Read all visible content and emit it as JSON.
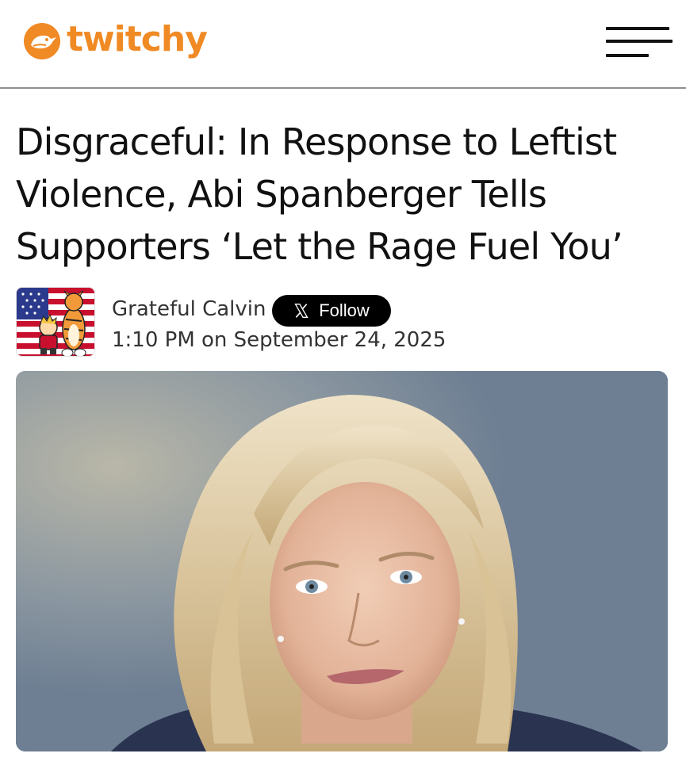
{
  "site": {
    "logo_text": "twitchy",
    "logo_icon": "bird-icon",
    "brand_color": "#f08a24",
    "menu_icon": "hamburger-menu-icon"
  },
  "article": {
    "title": "Disgraceful: In Response to Leftist Violence, Abi Spanberger Tells Supporters ‘Let the Rage Fuel You’",
    "author": {
      "name": "Grateful Calvin",
      "avatar_icon": "calvin-hobbes-flag-avatar",
      "follow_label": "Follow",
      "follow_icon": "x-logo-icon"
    },
    "timestamp": "1:10 PM on September 24, 2025",
    "hero_image_subject": "portrait-photo"
  }
}
